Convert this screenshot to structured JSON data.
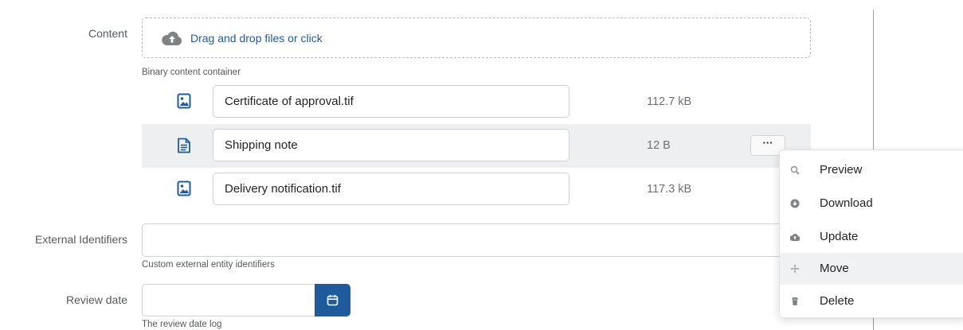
{
  "content_field": {
    "label": "Content",
    "dropzone_text": "Drag and drop files or click",
    "hint": "Binary content container",
    "files": [
      {
        "name": "Certificate of approval.tif",
        "size": "112.7 kB",
        "icon": "image-file-icon"
      },
      {
        "name": "Shipping note",
        "size": "12 B",
        "icon": "text-file-icon"
      },
      {
        "name": "Delivery notification.tif",
        "size": "117.3 kB",
        "icon": "image-file-icon"
      }
    ],
    "more_button_label": "···"
  },
  "context_menu": {
    "items": [
      {
        "label": "Preview",
        "icon": "search-icon"
      },
      {
        "label": "Download",
        "icon": "download-icon"
      },
      {
        "label": "Update",
        "icon": "cloud-upload-icon"
      },
      {
        "label": "Move",
        "icon": "move-icon"
      },
      {
        "label": "Delete",
        "icon": "trash-icon"
      }
    ],
    "active_item": "Move"
  },
  "external_identifiers": {
    "label": "External Identifiers",
    "value": "",
    "hint": "Custom external entity identifiers"
  },
  "review_date": {
    "label": "Review date",
    "value": "",
    "hint": "The review date log",
    "button_icon": "calendar-icon"
  },
  "colors": {
    "accent": "#1f5b9c",
    "link": "#235a9e",
    "row_highlight": "#eeeff0"
  }
}
